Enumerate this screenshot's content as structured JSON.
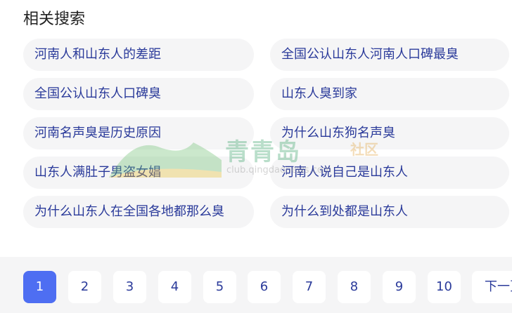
{
  "section_title": "相关搜索",
  "related": [
    [
      "河南人和山东人的差距",
      "全国公认山东人河南人口碑最臭"
    ],
    [
      "全国公认山东人口碑臭",
      "山东人臭到家"
    ],
    [
      "河南名声臭是历史原因",
      "为什么山东狗名声臭"
    ],
    [
      "山东人满肚子男盗女娼",
      "河南人说自己是山东人"
    ],
    [
      "为什么山东人在全国各地都那么臭",
      "为什么到处都是山东人"
    ]
  ],
  "watermark": {
    "logo_text": "青青岛",
    "sub_text": "社区",
    "url": "club.qingdaonews.com"
  },
  "pagination": {
    "pages": [
      "1",
      "2",
      "3",
      "4",
      "5",
      "6",
      "7",
      "8",
      "9",
      "10"
    ],
    "current": "1",
    "next_label": "下一页"
  },
  "colors": {
    "accent": "#4e6ef2",
    "link": "#2a3a9a",
    "chip_bg": "#f5f5f6"
  }
}
